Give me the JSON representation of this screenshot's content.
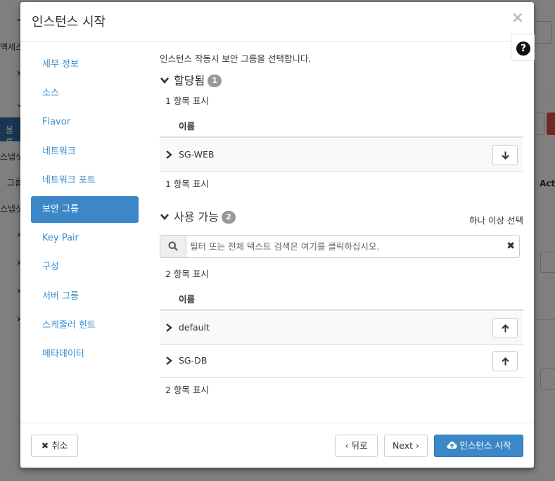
{
  "background": {
    "sidebar_fragments": [
      "액세스",
      "볼륨",
      "스냅샷",
      "그룹",
      "스냅샷"
    ],
    "column_fragment": "Act"
  },
  "modal": {
    "title": "인스턴스 시작",
    "close_glyph": "×",
    "help_glyph": "?"
  },
  "nav": {
    "items": [
      {
        "label": "세부 정보"
      },
      {
        "label": "소스"
      },
      {
        "label": "Flavor"
      },
      {
        "label": "네트워크"
      },
      {
        "label": "네트워크 포트"
      },
      {
        "label": "보안 그룹"
      },
      {
        "label": "Key Pair"
      },
      {
        "label": "구성"
      },
      {
        "label": "서버 그룹"
      },
      {
        "label": "스케줄러 힌트"
      },
      {
        "label": "메타데이터"
      }
    ],
    "active_index": 5
  },
  "content": {
    "description": "인스턴스 작동시 보안 그룹을 선택합니다.",
    "allocated": {
      "title": "할당됨",
      "badge": "1",
      "count_top": "1 항목 표시",
      "column_name": "이름",
      "rows": [
        {
          "name": "SG-WEB"
        }
      ],
      "count_bottom": "1 항목 표시"
    },
    "available": {
      "title": "사용 가능",
      "badge": "2",
      "select_hint": "하나 이상 선택",
      "search_placeholder": "필터 또는 전체 텍스트 검색은 여기를 클릭하십시오.",
      "clear_glyph": "✖",
      "count_top": "2 항목 표시",
      "column_name": "이름",
      "rows": [
        {
          "name": "default"
        },
        {
          "name": "SG-DB"
        }
      ],
      "count_bottom": "2 항목 표시"
    }
  },
  "footer": {
    "cancel_label": "취소",
    "back_label": "‹ 뒤로",
    "next_label": "Next ›",
    "launch_label": "인스턴스 시작"
  },
  "colors": {
    "accent": "#3b87c7",
    "link": "#3b8dcb",
    "badge": "#999999"
  }
}
